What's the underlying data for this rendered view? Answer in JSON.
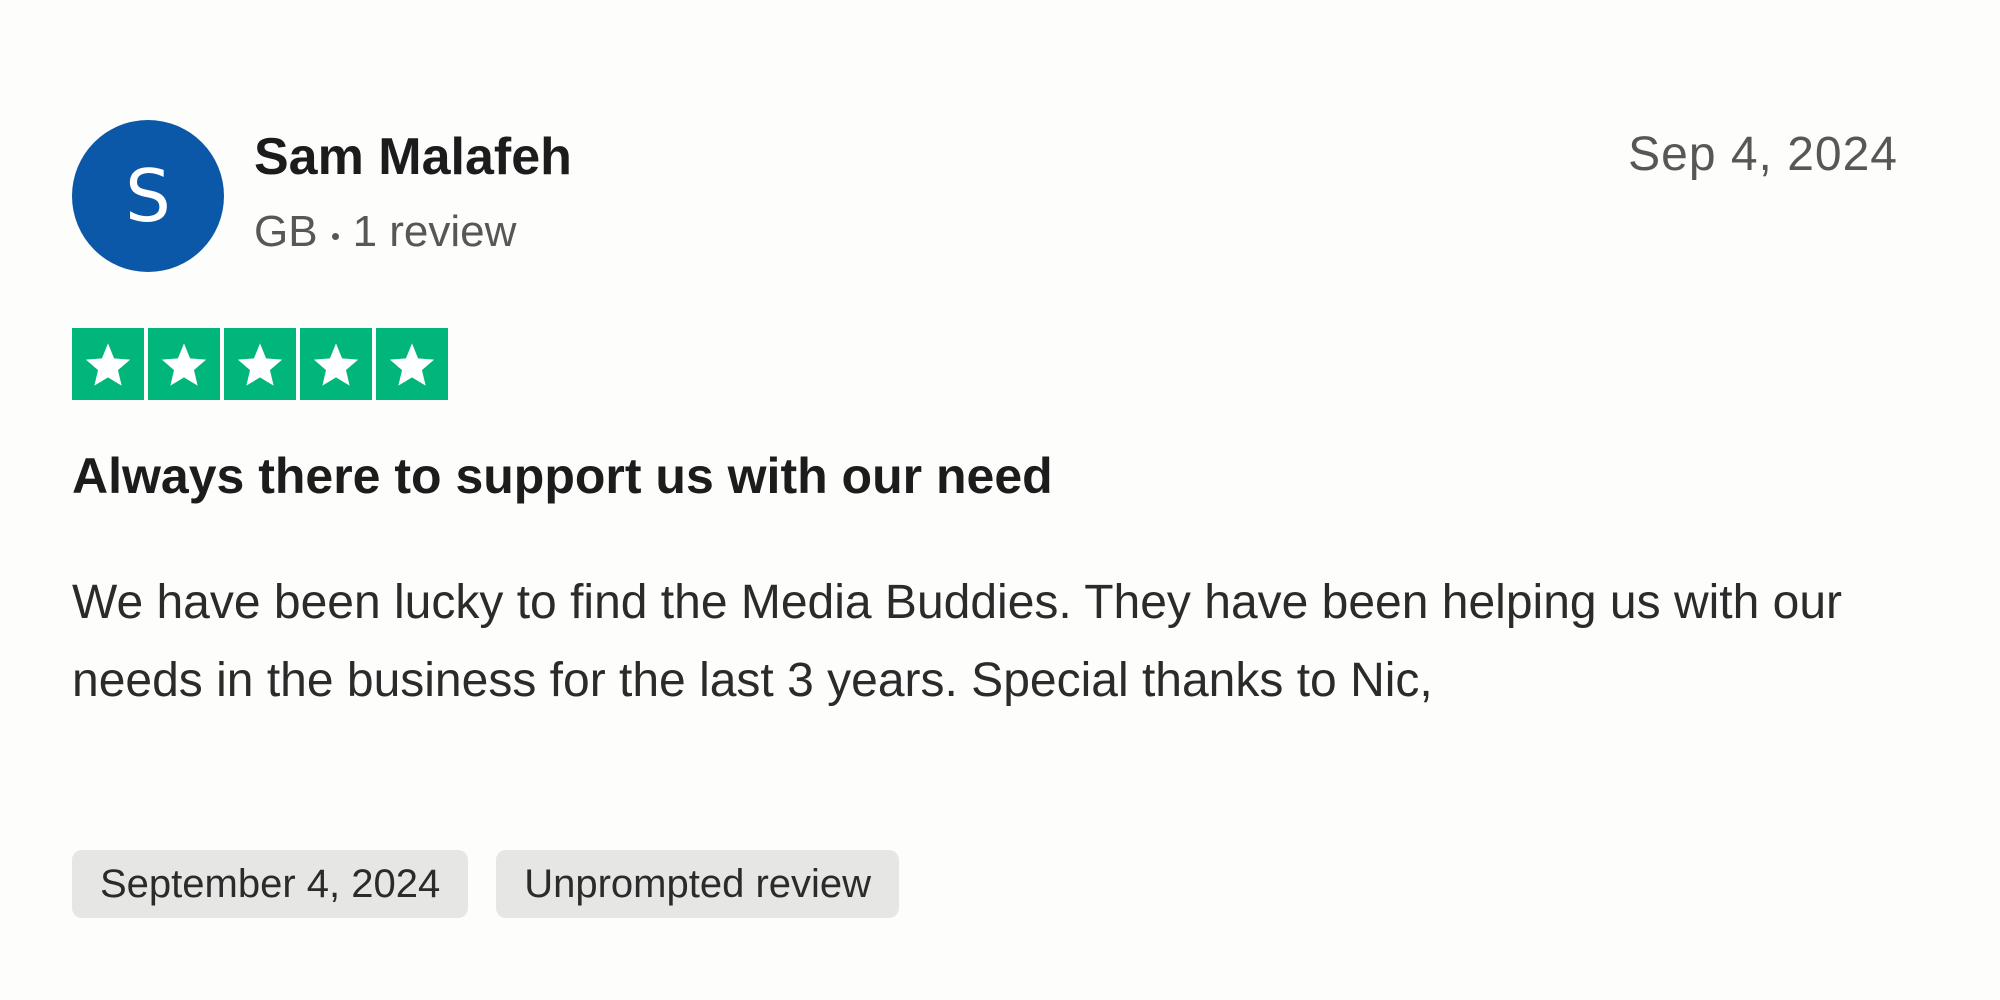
{
  "reviewer": {
    "initial": "S",
    "name": "Sam Malafeh",
    "country": "GB",
    "review_count": "1 review",
    "avatar_color": "#0b58a8"
  },
  "review": {
    "date_short": "Sep 4, 2024",
    "rating": 5,
    "rating_max": 5,
    "star_color": "#00b67a",
    "title": "Always there to support us with our need",
    "body": "We have been lucky to find the Media Buddies. They have been helping us with our needs in the business for the last 3 years. Special thanks to Nic,"
  },
  "tags": {
    "date_of_experience": "September 4, 2024",
    "review_type": "Unprompted review"
  },
  "icons": {
    "star": "star-icon"
  }
}
